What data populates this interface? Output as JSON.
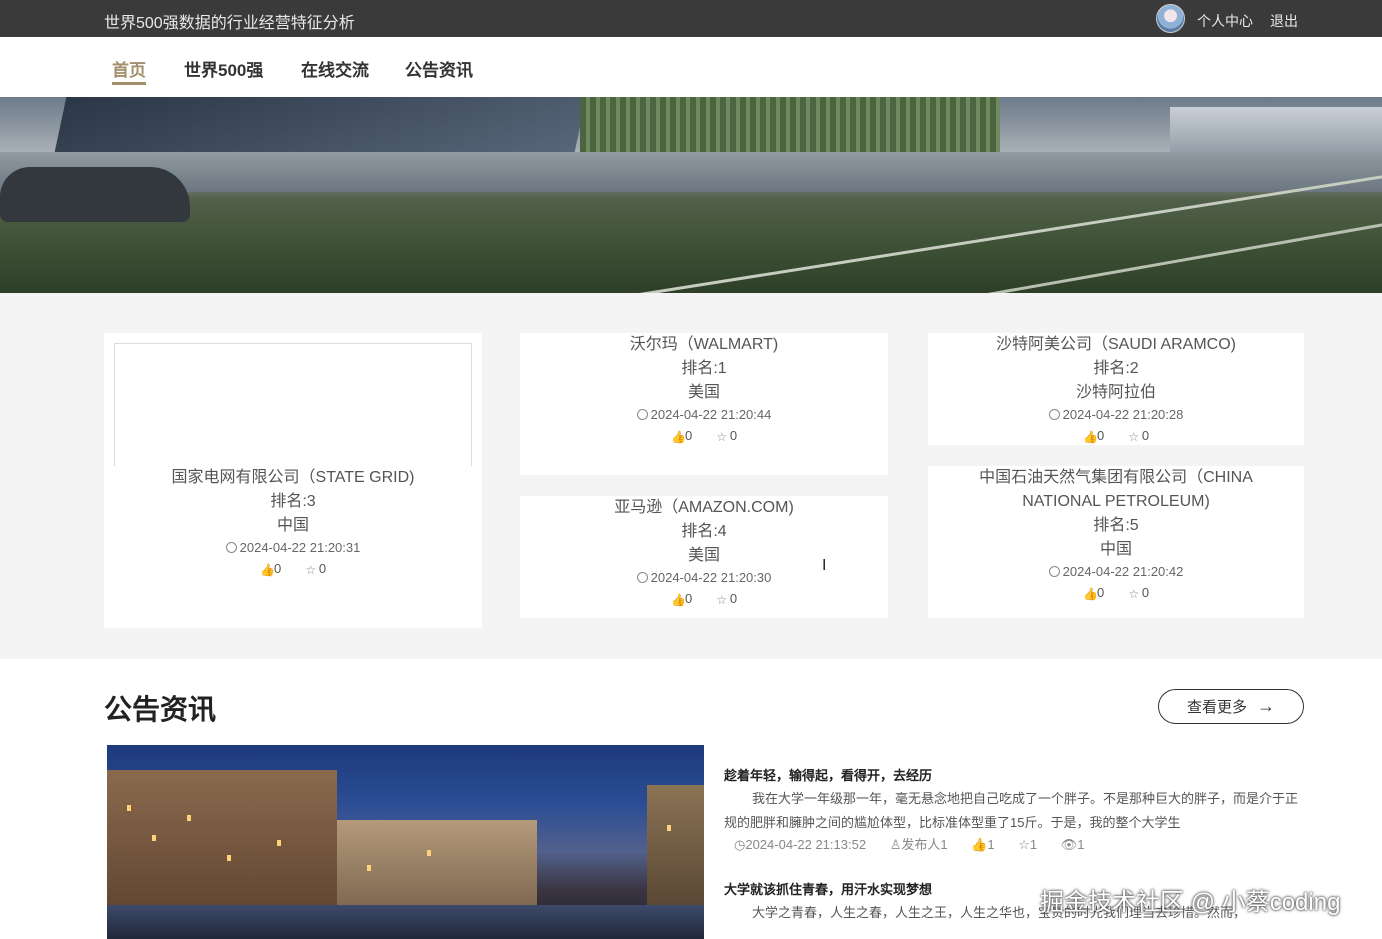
{
  "topbar": {
    "site_title": "世界500强数据的行业经营特征分析",
    "personal_center": "个人中心",
    "logout": "退出"
  },
  "nav": {
    "items": [
      "首页",
      "世界500强",
      "在线交流",
      "公告资讯"
    ],
    "active_index": 0
  },
  "banner": {
    "slide_count": 3,
    "active_slide": 0
  },
  "companies": [
    {
      "name": "国家电网有限公司（STATE GRID)",
      "rank": "排名:3",
      "country": "中国",
      "time": "2024-04-22 21:20:31",
      "likes": "0",
      "favorites": "0"
    },
    {
      "name": "沃尔玛（WALMART)",
      "rank": "排名:1",
      "country": "美国",
      "time": "2024-04-22 21:20:44",
      "likes": "0",
      "favorites": "0"
    },
    {
      "name": "沙特阿美公司（SAUDI ARAMCO)",
      "rank": "排名:2",
      "country": "沙特阿拉伯",
      "time": "2024-04-22 21:20:28",
      "likes": "0",
      "favorites": "0"
    },
    {
      "name": "亚马逊（AMAZON.COM)",
      "rank": "排名:4",
      "country": "美国",
      "time": "2024-04-22 21:20:30",
      "likes": "0",
      "favorites": "0"
    },
    {
      "name": "中国石油天然气集团有限公司（CHINA NATIONAL PETROLEUM)",
      "rank": "排名:5",
      "country": "中国",
      "time": "2024-04-22 21:20:42",
      "likes": "0",
      "favorites": "0"
    }
  ],
  "news_section": {
    "title": "公告资讯",
    "more_label": "查看更多",
    "more_arrow": "→",
    "items": [
      {
        "title": "趁着年轻，输得起，看得开，去经历",
        "excerpt": "我在大学一年级那一年，毫无悬念地把自己吃成了一个胖子。不是那种巨大的胖子，而是介于正规的肥胖和臃肿之间的尴尬体型，比标准体型重了15斤。于是，我的整个大学生",
        "time": "2024-04-22 21:13:52",
        "author": "发布人1",
        "likes": "1",
        "favorites": "1",
        "views": "1"
      },
      {
        "title": "大学就该抓住青春，用汗水实现梦想",
        "excerpt": "大学之青春，人生之春，人生之王，人生之华也，宝贵的时光我们理当去珍惜。然而，",
        "time": "",
        "author": "",
        "likes": "",
        "favorites": "",
        "views": ""
      }
    ]
  },
  "watermark": "掘金技术社区 @ 小蔡coding",
  "icons": {
    "clock": "clock-icon",
    "like": "thumbs-up-icon",
    "favorite": "star-icon",
    "author": "user-icon",
    "views": "eye-icon"
  }
}
